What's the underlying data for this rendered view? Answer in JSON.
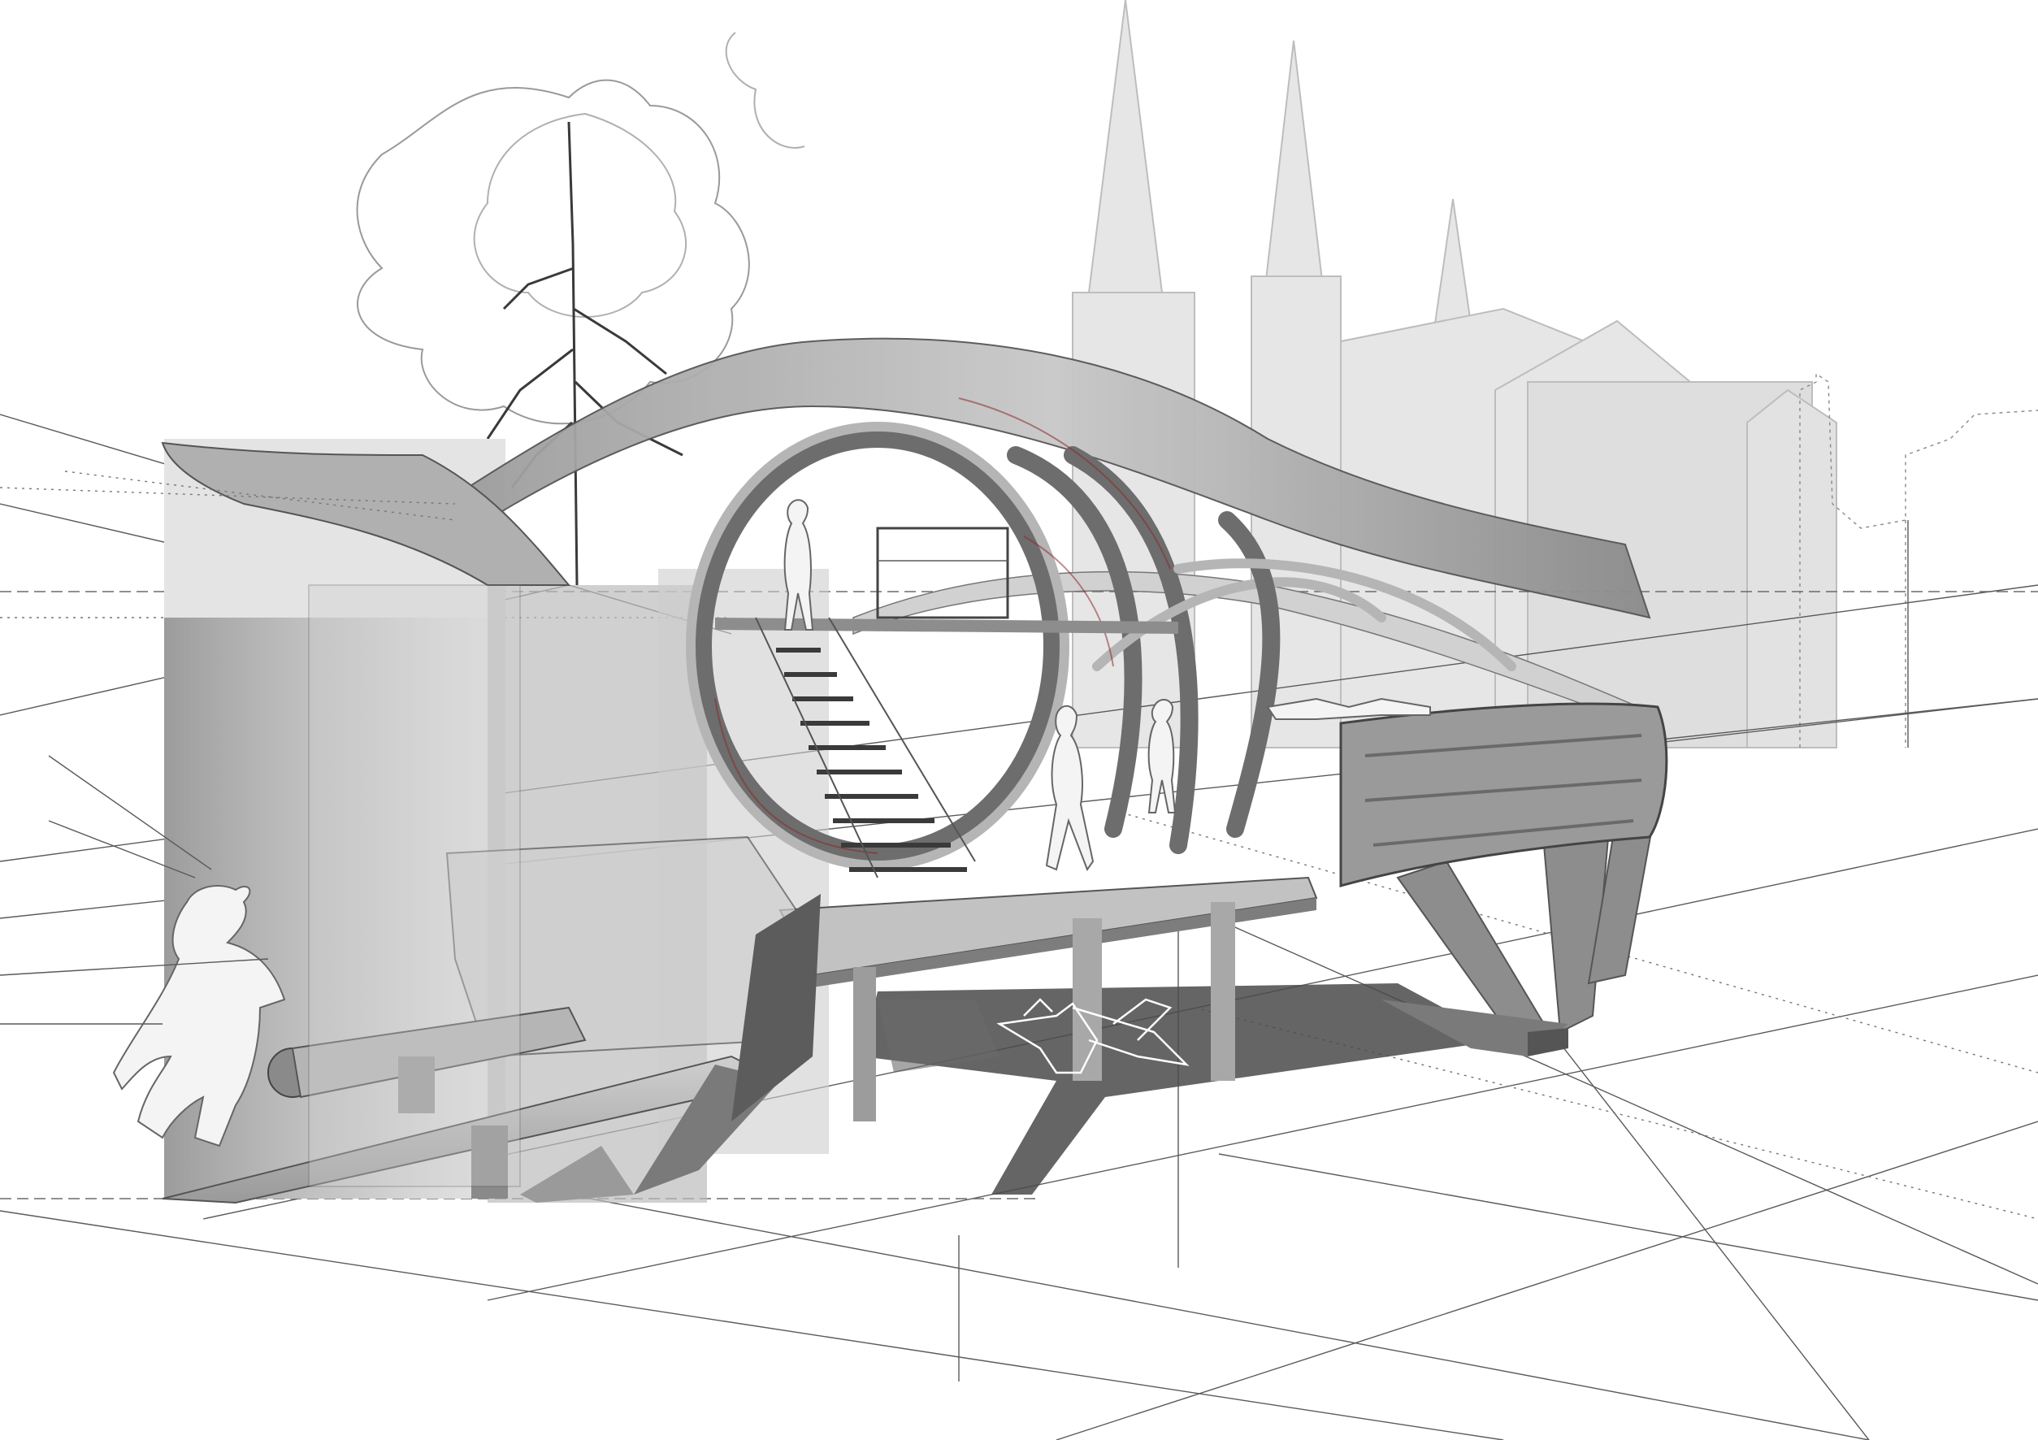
{
  "image": {
    "kind": "architectural perspective section drawing",
    "text_labels": []
  },
  "palette": {
    "background": "#ffffff",
    "line": "#5a5a5a",
    "structure_dark": "#6d6d6d",
    "structure_light": "#b5b5b5",
    "ghost_buildings": "#e3e3e3",
    "shadow": "#4a4a4a",
    "accent_red": "#8a2a2a"
  }
}
